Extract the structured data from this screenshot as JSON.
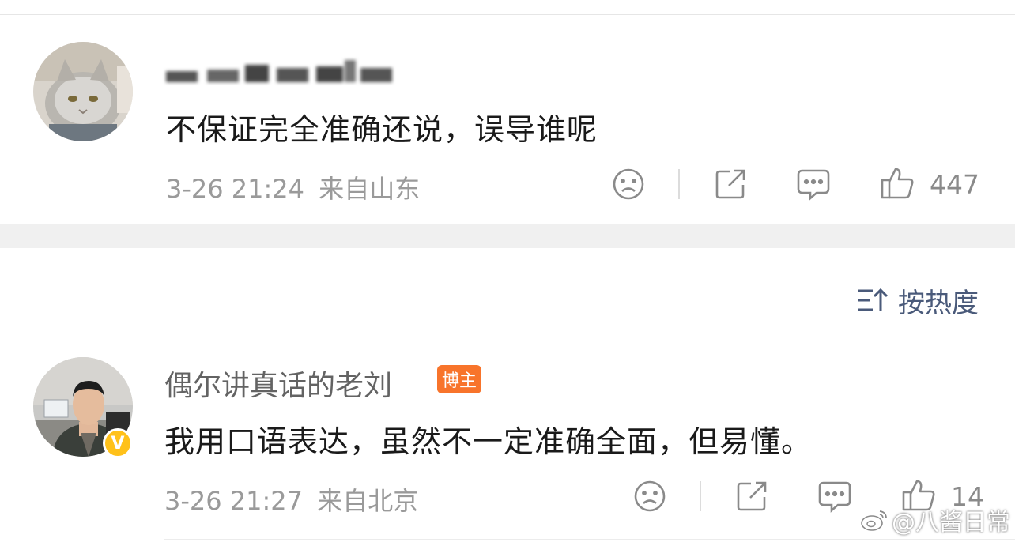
{
  "comments": [
    {
      "username": "",
      "content": "不保证完全准确还说，误导谁呢",
      "timestamp": "3-26 21:24",
      "location": "来自山东",
      "likes": "447",
      "avatar": "cat-avatar"
    },
    {
      "username": "偶尔讲真话的老刘",
      "badge": "博主",
      "verified_mark": "V",
      "content": "我用口语表达，虽然不一定准确全面，但易懂。",
      "timestamp": "3-26 21:27",
      "location": "来自北京",
      "likes": "14",
      "avatar": "man-avatar"
    }
  ],
  "sort": {
    "label": "按热度",
    "icon": "sort-icon"
  },
  "watermark": {
    "text": "@八酱日常",
    "icon": "weibo-logo-icon"
  },
  "colors": {
    "badge": "#f8742b",
    "verified": "#ffc11a",
    "sort_text": "#4a5a7a"
  }
}
